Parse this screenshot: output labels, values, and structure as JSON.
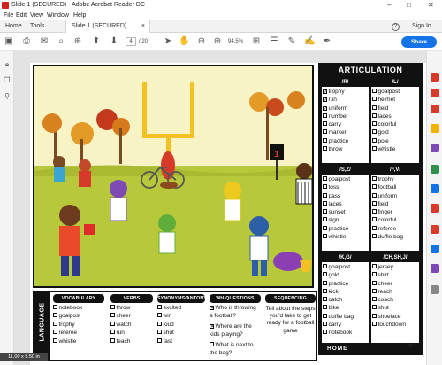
{
  "window": {
    "title": "Slide 1 (SECURED) - Adobe Acrobat Reader DC"
  },
  "menu": [
    "File",
    "Edit",
    "View",
    "Window",
    "Help"
  ],
  "tabs": {
    "home": "Home",
    "tools": "Tools",
    "document": "Slide 1 (SECURED)",
    "close": "×",
    "sign_in": "Sign In",
    "help": "?"
  },
  "toolbar": {
    "page_current": "4",
    "page_total": "/ 20",
    "zoom": "94.5%",
    "share": "Share"
  },
  "page_size": "11.00 x 8.50 in",
  "articulation": {
    "title": "ARTICULATION",
    "footer": "HOME",
    "sections": [
      {
        "label": "/R/",
        "words": [
          "trophy",
          "run",
          "uniform",
          "number",
          "carry",
          "marker",
          "practice",
          "throw"
        ],
        "checked": [
          true,
          true,
          true,
          false,
          false,
          false,
          false,
          false
        ]
      },
      {
        "label": "/L/",
        "words": [
          "goalpost",
          "helmet",
          "field",
          "laces",
          "colorful",
          "gold",
          "pole",
          "whistle"
        ],
        "checked": [
          false,
          false,
          false,
          false,
          false,
          false,
          false,
          false
        ]
      },
      {
        "label": "/S,Z/",
        "words": [
          "goalpost",
          "toss",
          "pass",
          "laces",
          "sunset",
          "sign",
          "practice",
          "whistle"
        ],
        "checked": [
          false,
          false,
          false,
          false,
          false,
          false,
          false,
          false
        ]
      },
      {
        "label": "/F,V/",
        "words": [
          "trophy",
          "football",
          "uniform",
          "field",
          "finger",
          "colorful",
          "referee",
          "duffle bag"
        ],
        "checked": [
          false,
          false,
          false,
          false,
          false,
          false,
          false,
          false
        ]
      },
      {
        "label": "/K,G/",
        "words": [
          "goalpost",
          "gold",
          "practice",
          "kick",
          "catch",
          "bike",
          "duffle bag",
          "carry",
          "notebook"
        ],
        "checked": [
          false,
          false,
          false,
          false,
          false,
          false,
          false,
          false,
          false
        ]
      },
      {
        "label": "/CH,SH,J/",
        "words": [
          "jersey",
          "shirt",
          "cheer",
          "reach",
          "coach",
          "shut",
          "shoelace",
          "touchdown"
        ],
        "checked": [
          false,
          false,
          false,
          false,
          false,
          false,
          false,
          false
        ]
      }
    ]
  },
  "language": {
    "side_label": "LANGUAGE",
    "vocabulary": {
      "header": "VOCABULARY",
      "words": [
        "notebook",
        "goalpost",
        "trophy",
        "referee",
        "whistle"
      ]
    },
    "verbs": {
      "header": "VERBS",
      "words": [
        "throw",
        "cheer",
        "watch",
        "run",
        "teach"
      ]
    },
    "synonyms": {
      "header": "SYNONYMS/ANTONYMS",
      "words": [
        "excited",
        "win",
        "loud",
        "shut",
        "fast"
      ]
    },
    "wh": {
      "header": "WH-QUESTIONS",
      "questions": [
        "Who is throwing a football?",
        "Where are the kids playing?",
        "What is next to the bag?"
      ],
      "checked": [
        true,
        true,
        false
      ]
    },
    "sequencing": {
      "header": "SEQUENCING",
      "text": "Tell about the steps you'd take to get ready for a football game"
    }
  },
  "page_label": "pg 4",
  "scene": {
    "sign_number": "1"
  },
  "colors": {
    "accent": "#1473e6",
    "acrobat_red": "#d3221b",
    "panel_black": "#111111",
    "sky": "#f7f3c4",
    "grass": "#b7c93a"
  }
}
